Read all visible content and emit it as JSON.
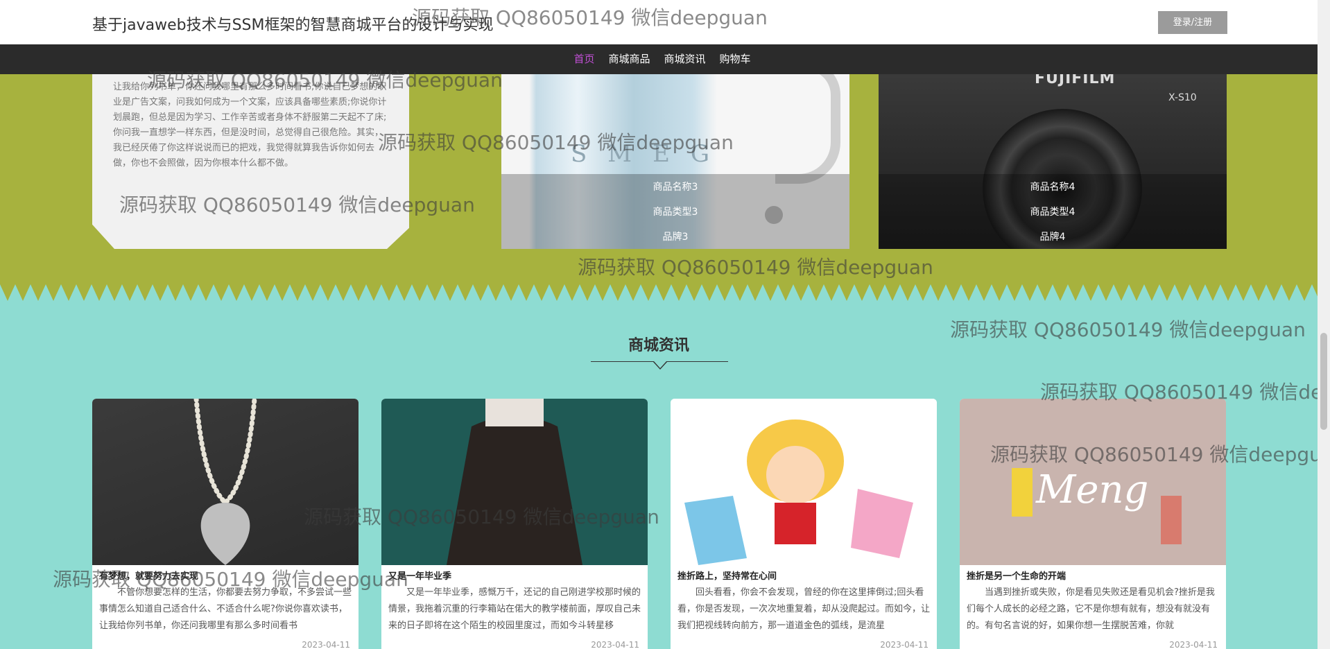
{
  "header": {
    "site_title": "基于javaweb技术与SSM框架的智慧商城平台的设计与实现",
    "login_label": "登录/注册"
  },
  "nav": {
    "items": [
      {
        "label": "首页",
        "active": true
      },
      {
        "label": "商城商品",
        "active": false
      },
      {
        "label": "商城资讯",
        "active": false
      },
      {
        "label": "购物车",
        "active": false
      }
    ]
  },
  "intro": {
    "text": "让我给你列书单，你还问我哪里有那么多时间看书;你说自己梦想的职业是广告文案，问我如何成为一个文案，应该具备哪些素质;你说你计划晨跑，但总是因为学习、工作辛苦或者身体不舒服第二天起不了床;你问我一直想学一样东西，但是没时间，总觉得自己很危险。其实，我已经厌倦了你这样说说而已的把戏，我觉得就算我告诉你如何去做，你也不会照做，因为你根本什么都不做。"
  },
  "products": [
    {
      "name": "商品名称3",
      "type": "商品类型3",
      "brand": "品牌3",
      "image": "smeg-kettle"
    },
    {
      "name": "商品名称4",
      "type": "商品类型4",
      "brand": "品牌4",
      "image": "fujifilm-camera",
      "image_brand": "FUJIFILM",
      "image_model": "X-S10"
    }
  ],
  "news": {
    "section_title": "商城资讯",
    "cards": [
      {
        "title": "有梦想，就要努力去实现",
        "text": "不管你想要怎样的生活，你都要去努力争取，不多尝试一些事情怎么知道自己适合什么、不适合什么呢?你说你喜欢读书，让我给你列书单，你还问我哪里有那么多时间看书",
        "date": "2023-04-11"
      },
      {
        "title": "又是一年毕业季",
        "text": "又是一年毕业季，感慨万千，还记的自己刚进学校那时候的情景，我拖着沉重的行李箱站在偌大的教学楼前面，厚叹自己未来的日子即将在这个陌生的校园里度过，而如今斗转星移",
        "date": "2023-04-11"
      },
      {
        "title": "挫折路上，坚持常在心间",
        "text": "回头看看，你会不会发现，曾经的你在这里摔倒过;回头看看，你是否发现，一次次地重复着，却从没爬起过。而如今，让我们把视线转向前方，那一道道金色的弧线，是流星",
        "date": "2023-04-11"
      },
      {
        "title": "挫折是另一个生命的开端",
        "text": "当遇到挫折或失败，你是看见失败还是看见机会?挫折是我们每个人成长的必经之路，它不是你想有就有，想没有就没有的。有句名言说的好，如果你想一生摆脱苦难，你就",
        "date": "2023-04-11"
      }
    ]
  },
  "watermark": "源码获取 QQ86050149 微信deepguan",
  "colors": {
    "green_section": "#a7b23e",
    "teal_section": "#8edcd2",
    "nav_bg": "#2b2b2b",
    "active_nav": "#c24fd6",
    "login_bg": "#9b9b9b"
  }
}
